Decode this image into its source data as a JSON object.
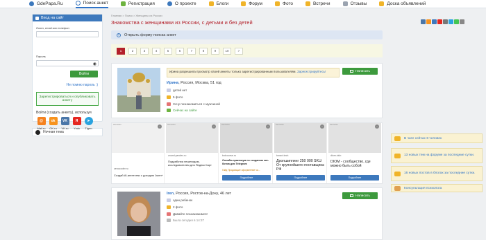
{
  "nav": {
    "items": [
      {
        "label": "GdePapa.Ru",
        "icon": "logo-icon",
        "color": "#3d79bd"
      },
      {
        "label": "Поиск анкет",
        "icon": "search-icon",
        "color": "#3d79bd",
        "active": true
      },
      {
        "label": "Регистрация",
        "icon": "registration-icon",
        "color": "#6db33f"
      },
      {
        "label": "О проекте",
        "icon": "info-icon",
        "color": "#3d79bd"
      },
      {
        "label": "Блоги",
        "icon": "blog-icon",
        "color": "#f0b429"
      },
      {
        "label": "Форум",
        "icon": "forum-icon",
        "color": "#f0b429"
      },
      {
        "label": "Фото",
        "icon": "photo-icon",
        "color": "#f0b429"
      },
      {
        "label": "Встречи",
        "icon": "meetings-icon",
        "color": "#f0b429"
      },
      {
        "label": "Отзывы",
        "icon": "reviews-icon",
        "color": "#9aa3b0"
      },
      {
        "label": "Доска объявлений",
        "icon": "board-icon",
        "color": "#f0b429"
      }
    ]
  },
  "login": {
    "header": "Вход на сайт",
    "login_label": "Логин, email или телефон",
    "password_label": "Пароль",
    "submit": "Войти",
    "forgot": "Не помню пароль :)",
    "register": "Зарегистрироваться и опубликовать анкету",
    "social_title": "Войти (создать анкету), используя",
    "socials": [
      {
        "label": "Mail.ru",
        "icon": "mailru-icon",
        "glyph": "@",
        "color": "#f58220"
      },
      {
        "label": "OK.ru",
        "icon": "ok-icon",
        "glyph": "ok",
        "color": "#f7931e"
      },
      {
        "label": "VK.ru",
        "icon": "vk-icon",
        "glyph": "VK",
        "color": "#4a76a8"
      },
      {
        "label": "Yndx",
        "icon": "yandex-icon",
        "glyph": "Я",
        "color": "#e52620"
      },
      {
        "label": "Tlgrm",
        "icon": "telegram-icon",
        "glyph": "➤",
        "color": "#2aa3df"
      }
    ]
  },
  "theme": {
    "label": "Ночная тема"
  },
  "breadcrumb": "Главная > Поиск > Женщины из России",
  "page_title": "Знакомства с женщинами из России, с детьми и без детей",
  "form_toggle": "Открыть форму поиска анкет",
  "pagination": [
    "1",
    "2",
    "3",
    "4",
    "5",
    "6",
    "7",
    "8",
    "9",
    "10",
    ">"
  ],
  "profiles": [
    {
      "notice": "Ирина разрешила просмотр своей анкеты только зарегистрированным пользователям.",
      "notice_link": "Зарегистрируйтесь!",
      "write": "Написать",
      "name": "Ирина",
      "location": ", Россия, Москва, 51 год",
      "props": [
        "детей нет",
        "5 фото",
        "Хочу познакомиться с мужчиной"
      ],
      "status": "Сейчас на сайте"
    },
    {
      "write": "Написать",
      "name": "Iren",
      "location": ", Россия, Ростов-на-Дону, 46 лет",
      "props": [
        "один ребенок",
        "2 фото",
        "Давайте познакомимся!"
      ],
      "status": "Была сегодня в 14:37"
    }
  ],
  "ads": [
    {
      "tag": "РЕКЛАМА",
      "source": "zenocoder.ru",
      "title": "Создай AI-агентство с доходом 1млн+"
    },
    {
      "tag": "РЕКЛАМА",
      "source": "crowd.yandex.ru",
      "title": "Подработка пешеходом-исследователем для Яндекс Карт"
    },
    {
      "tag": "РЕКЛАМА",
      "source": "botcourse.ru",
      "title": "Онлайн-практикум по созданию чат-ботов для Telegram",
      "extra": "Гайд Продающие оформление ча...",
      "button": "Подробнее"
    },
    {
      "tag": "РЕКЛАМА",
      "source": "tonavi.tech",
      "title": "Дропшиппинг 250 000 SKU: От крупнейшего поставщика РФ",
      "button": "Подробнее"
    },
    {
      "tag": "РЕКЛАМА",
      "source": "diom.club",
      "title": "DIOM - сообщество, где можно быть собой",
      "button": "Подробнее"
    }
  ],
  "sidebar_right": [
    {
      "label": "В чате сейчас 8 человек",
      "icon": "chat-icon",
      "color": "#f0b429"
    },
    {
      "label": "13 новых тем на форуме за последние сутки.",
      "icon": "forum-topics-icon",
      "color": "#f0b429"
    },
    {
      "label": "16 новых постов в блогах за последние сутки.",
      "icon": "blog-posts-icon",
      "color": "#f0b429"
    },
    {
      "label": "Консультация психолога",
      "icon": "psychologist-icon",
      "color": "#e0a050"
    }
  ],
  "share_colors": [
    "#4a76a8",
    "#f7931e",
    "#3d79bd",
    "#e52620",
    "#777",
    "#2aa3df",
    "#43c553",
    "#888"
  ]
}
